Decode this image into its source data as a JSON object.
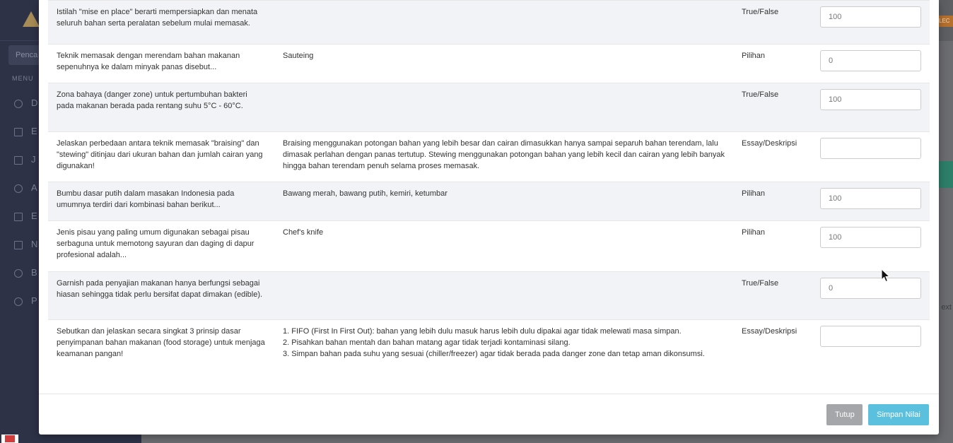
{
  "background": {
    "search_placeholder": "Penca",
    "menu_label": "MENU",
    "menu_items": [
      "D",
      "E",
      "J",
      "A",
      "E",
      "N",
      "B",
      "P"
    ],
    "badge": "LEC",
    "next_label": "ext"
  },
  "rows": [
    {
      "question": "Istilah \"mise en place\" berarti mempersiapkan dan menata seluruh bahan serta peralatan sebelum mulai memasak.",
      "answer": "",
      "type": "True/False",
      "score": "100"
    },
    {
      "question": "Teknik memasak dengan merendam bahan makanan sepenuhnya ke dalam minyak panas disebut...",
      "answer": "Sauteing",
      "type": "Pilihan",
      "score": "0"
    },
    {
      "question": "Zona bahaya (danger zone) untuk pertumbuhan bakteri pada makanan berada pada rentang suhu 5°C - 60°C.",
      "answer": "",
      "type": "True/False",
      "score": "100"
    },
    {
      "question": "Jelaskan perbedaan antara teknik memasak \"braising\" dan \"stewing\" ditinjau dari ukuran bahan dan jumlah cairan yang digunakan!",
      "answer": "Braising menggunakan potongan bahan yang lebih besar dan cairan dimasukkan hanya sampai separuh bahan terendam, lalu dimasak perlahan dengan panas tertutup. Stewing menggunakan potongan bahan yang lebih kecil dan cairan yang lebih banyak hingga bahan terendam penuh selama proses memasak.",
      "type": "Essay/Deskripsi",
      "score": ""
    },
    {
      "question": "Bumbu dasar putih dalam masakan Indonesia pada umumnya terdiri dari kombinasi bahan berikut...",
      "answer": "Bawang merah, bawang putih, kemiri, ketumbar",
      "type": "Pilihan",
      "score": "100"
    },
    {
      "question": "Jenis pisau yang paling umum digunakan sebagai pisau serbaguna untuk memotong sayuran dan daging di dapur profesional adalah...",
      "answer": "Chef's knife",
      "type": "Pilihan",
      "score": "100"
    },
    {
      "question": "Garnish pada penyajian makanan hanya berfungsi sebagai hiasan sehingga tidak perlu bersifat dapat dimakan (edible).",
      "answer": "",
      "type": "True/False",
      "score": "0"
    },
    {
      "question": "Sebutkan dan jelaskan secara singkat 3 prinsip dasar penyimpanan bahan makanan (food storage) untuk menjaga keamanan pangan!",
      "answer": "1. FIFO (First In First Out): bahan yang lebih dulu masuk harus lebih dulu dipakai agar tidak melewati masa simpan.\n2. Pisahkan bahan mentah dan bahan matang agar tidak terjadi kontaminasi silang.\n3. Simpan bahan pada suhu yang sesuai (chiller/freezer) agar tidak berada pada danger zone dan tetap aman dikonsumsi.",
      "type": "Essay/Deskripsi",
      "score": ""
    }
  ],
  "footer": {
    "close_label": "Tutup",
    "save_label": "Simpan Nilai"
  },
  "colors": {
    "save_button": "#5bc0de",
    "close_button": "#a4a6aa",
    "row_stripe": "#f1f3f6"
  }
}
